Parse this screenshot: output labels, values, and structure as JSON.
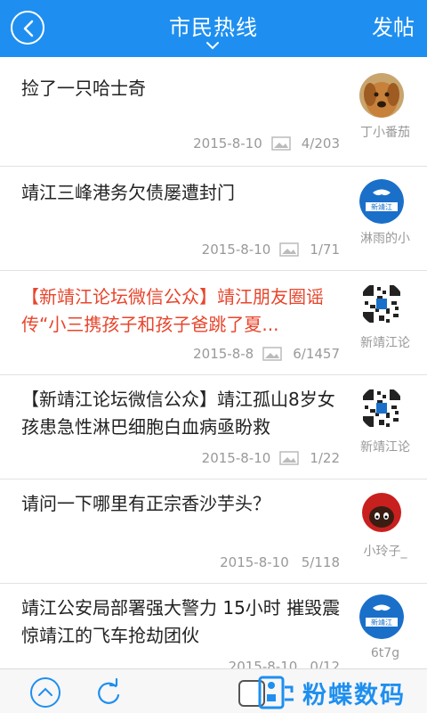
{
  "header": {
    "title": "市民热线",
    "post_label": "发帖"
  },
  "posts": [
    {
      "title": "捡了一只哈士奇",
      "date": "2015-8-10",
      "has_image": true,
      "stats": "4/203",
      "author": "丁小番茄",
      "avatar": "dog-avatar"
    },
    {
      "title": "靖江三峰港务欠债屡遭封门",
      "date": "2015-8-10",
      "has_image": true,
      "stats": "1/71",
      "author": "淋雨的小",
      "avatar": "xinjingjiang-logo"
    },
    {
      "title": "【新靖江论坛微信公众】靖江朋友圈谣传“小三携孩子和孩子爸跳了夏...",
      "date": "2015-8-8",
      "has_image": true,
      "stats": "6/1457",
      "author": "新靖江论",
      "avatar": "qr-code",
      "highlight": true
    },
    {
      "title": "【新靖江论坛微信公众】靖江孤山8岁女孩患急性淋巴细胞白血病亟盼救",
      "date": "2015-8-10",
      "has_image": true,
      "stats": "1/22",
      "author": "新靖江论",
      "avatar": "qr-code"
    },
    {
      "title": "请问一下哪里有正宗香沙芋头？",
      "date": "2015-8-10",
      "has_image": false,
      "stats": "5/118",
      "author": "小玲子_",
      "avatar": "cartoon-avatar"
    },
    {
      "title": "靖江公安局部署强大警力 15小时 摧毁震惊靖江的飞车抢劫团伙",
      "date": "2015-8-10",
      "has_image": false,
      "stats": "0/12",
      "author": "6t7g",
      "avatar": "xinjingjiang-logo"
    }
  ],
  "watermark": {
    "text": "粉蝶数码"
  },
  "colors": {
    "accent": "#1e8ff0",
    "highlight": "#e8452c",
    "meta": "#999999"
  }
}
